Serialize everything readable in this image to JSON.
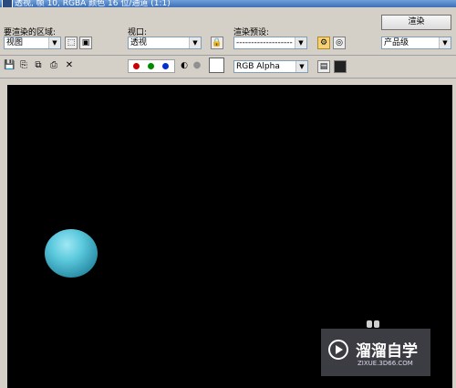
{
  "window": {
    "title": "透视, 帧 10, RGBA 颜色 16 位/通道 (1:1)"
  },
  "area": {
    "label": "要渲染的区域:",
    "value": "视图"
  },
  "viewport": {
    "label": "视口:",
    "value": "透视"
  },
  "preset": {
    "label": "渲染预设:",
    "value": "-------------------"
  },
  "render": {
    "button_label": "渲染",
    "mode_value": "产品级"
  },
  "channel": {
    "value": "RGB Alpha"
  },
  "colors": {
    "red": "#cc0000",
    "green": "#008a00",
    "blue": "#0033cc",
    "sphere": "#5cc9dd"
  },
  "watermark": {
    "text": "溜溜自学",
    "url": "ZIXUE.3D66.COM"
  }
}
